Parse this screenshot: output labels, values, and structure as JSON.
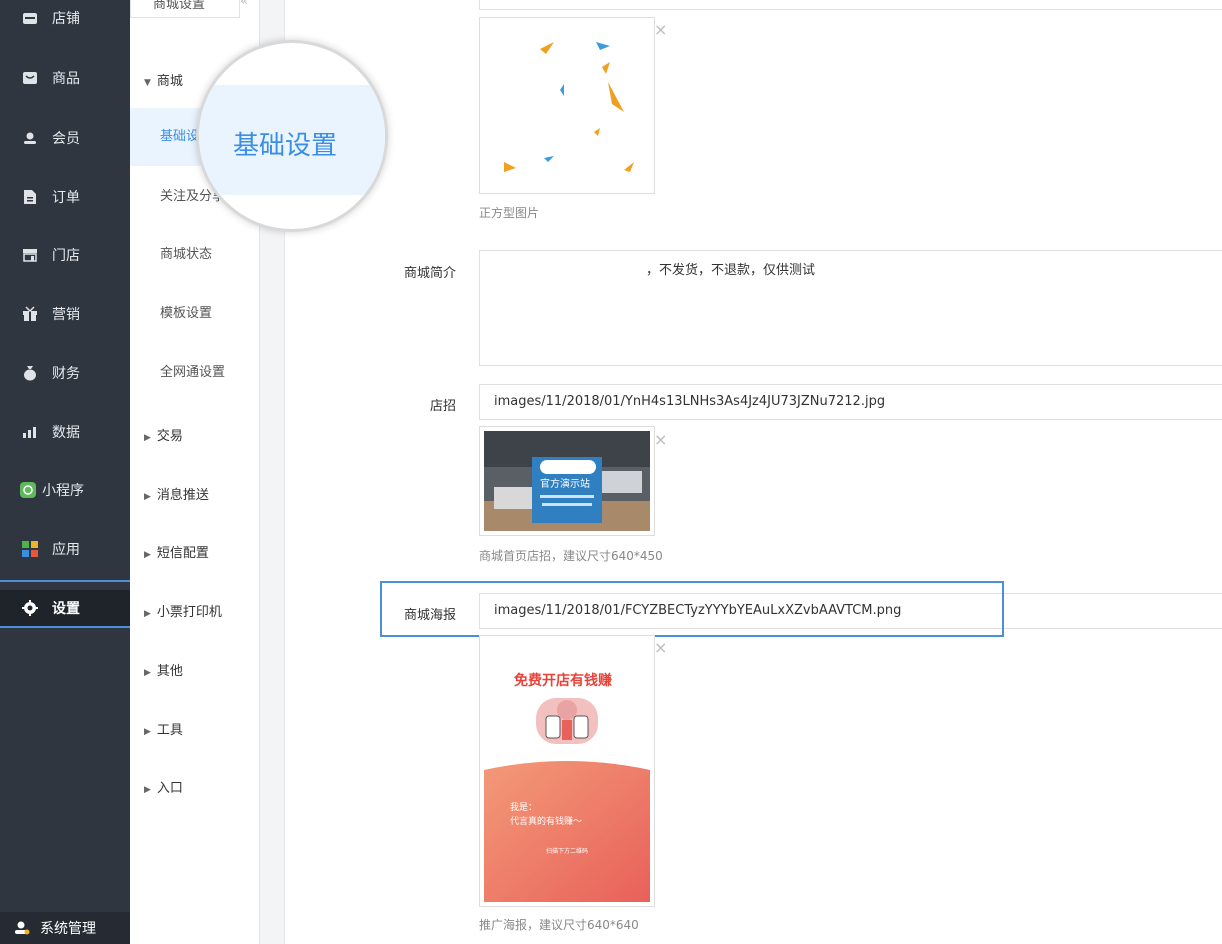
{
  "nav": {
    "items": [
      {
        "label": "店铺",
        "icon": "store-icon"
      },
      {
        "label": "商品",
        "icon": "goods-icon"
      },
      {
        "label": "会员",
        "icon": "member-icon"
      },
      {
        "label": "订单",
        "icon": "order-icon"
      },
      {
        "label": "门店",
        "icon": "shop-icon"
      },
      {
        "label": "营销",
        "icon": "gift-icon"
      },
      {
        "label": "财务",
        "icon": "money-bag-icon"
      },
      {
        "label": "数据",
        "icon": "chart-icon"
      },
      {
        "label": "小程序",
        "icon": "miniprogram-icon"
      },
      {
        "label": "应用",
        "icon": "apps-icon"
      },
      {
        "label": "设置",
        "icon": "gear-icon"
      }
    ],
    "bottom_label": "系统管理"
  },
  "subnav": {
    "header": "商城设置",
    "group_mall": "商城",
    "items": [
      "基础设置",
      "关注及分享",
      "商城状态",
      "模板设置",
      "全网通设置"
    ],
    "groups": [
      "交易",
      "消息推送",
      "短信配置",
      "小票打印机",
      "其他",
      "工具",
      "入口"
    ]
  },
  "magnifier": {
    "text": "基础设置"
  },
  "form": {
    "logo_hint": "正方型图片",
    "intro_label": "商城简介",
    "intro_value": "，不发货，不退款，仅供测试",
    "sign_label": "店招",
    "sign_value": "images/11/2018/01/YnH4s13LNHs3As4Jz4JU73JZNu7212.jpg",
    "sign_hint": "商城首页店招，建议尺寸640*450",
    "sign_image_text": "官方演示站",
    "poster_label": "商城海报",
    "poster_value": "images/11/2018/01/FCYZBECTyzYYYbYEAuLxXZvbAAVTCM.png",
    "poster_hint": "推广海报，建议尺寸640*640",
    "poster_title": "免费开店有钱赚",
    "poster_text1": "我是：",
    "poster_text2": "代言真的有钱赚～",
    "poster_text3": "扫描下方二维码"
  },
  "close_symbol": "×"
}
